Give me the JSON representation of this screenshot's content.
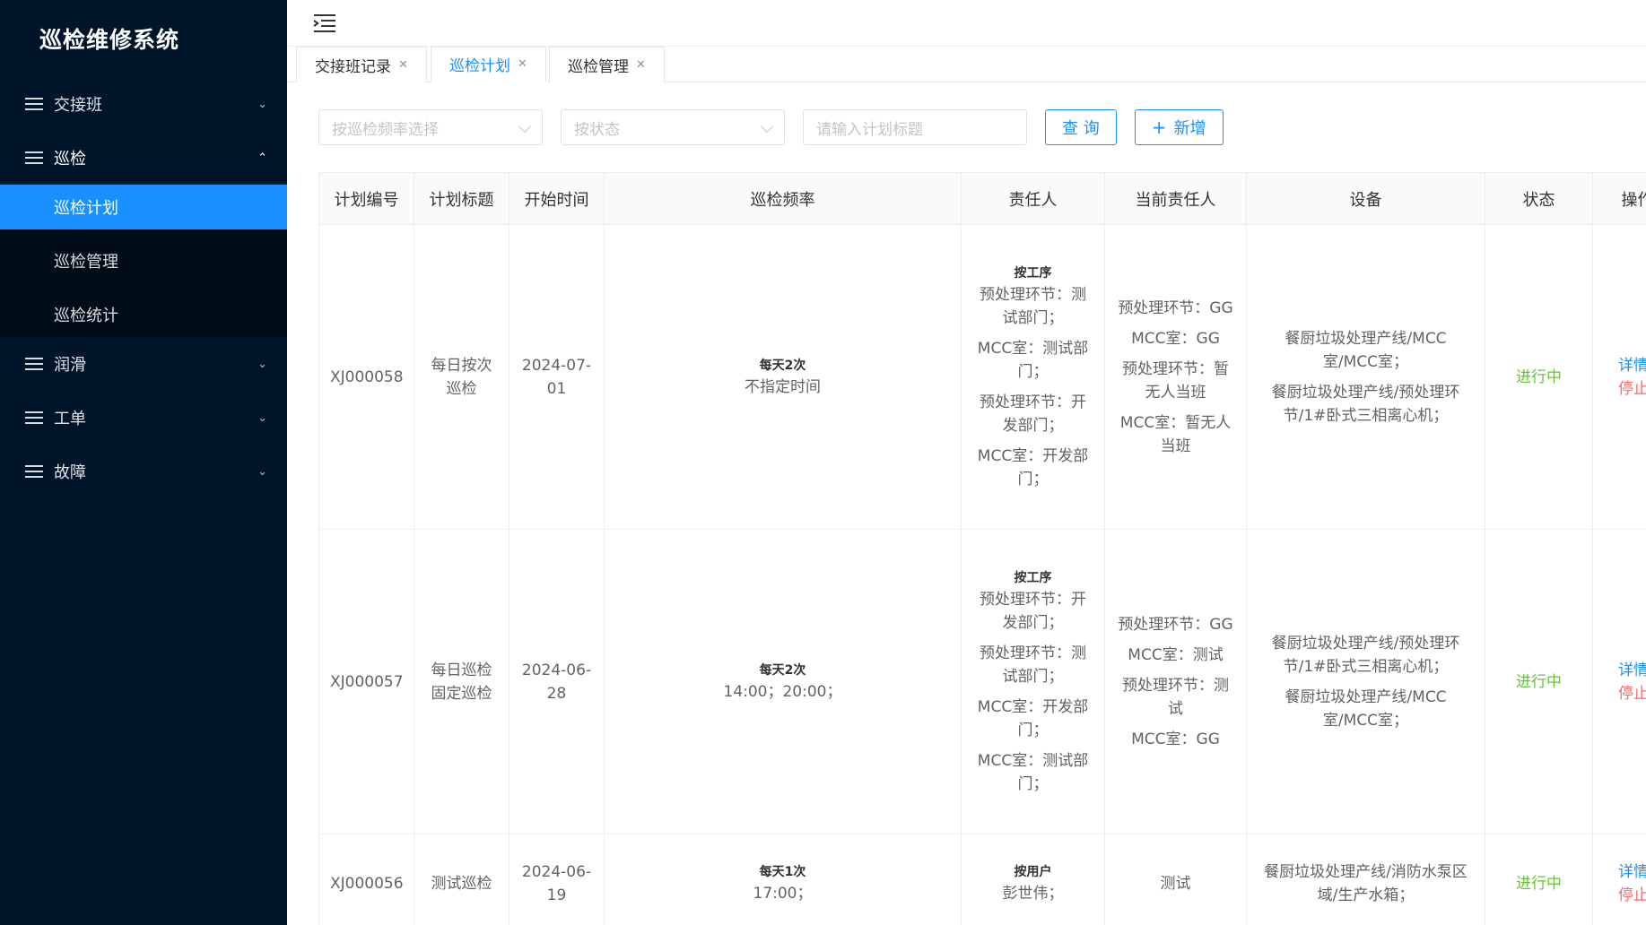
{
  "app": {
    "title": "巡检维修系统"
  },
  "sidebar": {
    "menu": [
      {
        "label": "交接班",
        "expanded": false
      },
      {
        "label": "巡检",
        "expanded": true
      },
      {
        "label": "润滑",
        "expanded": false
      },
      {
        "label": "工单",
        "expanded": false
      },
      {
        "label": "故障",
        "expanded": false
      }
    ],
    "inspection_sub": [
      "巡检计划",
      "巡检管理",
      "巡检统计"
    ]
  },
  "tabs": [
    {
      "label": "交接班记录"
    },
    {
      "label": "巡检计划",
      "active": true
    },
    {
      "label": "巡检管理"
    }
  ],
  "filters": {
    "frequency_placeholder": "按巡检频率选择",
    "status_placeholder": "按状态",
    "title_placeholder": "请输入计划标题",
    "query_label": "查 询",
    "add_label": "新增"
  },
  "table": {
    "headers": [
      "计划编号",
      "计划标题",
      "开始时间",
      "巡检频率",
      "责任人",
      "当前责任人",
      "设备",
      "状态",
      "操作"
    ],
    "rows": [
      {
        "id": "XJ000058",
        "title_lines": [
          "每日按次",
          "巡检"
        ],
        "start_lines": [
          "2024-07-",
          "01"
        ],
        "freq_head": "每天2次",
        "freq_detail": "不指定时间",
        "owner_head": "按工序",
        "owner_lines": [
          "预处理环节：测",
          "试部门；",
          "",
          "MCC室：测试部",
          "门；",
          "",
          "预处理环节：开",
          "发部门；",
          "",
          "MCC室：开发部",
          "门；"
        ],
        "current_lines": [
          "预处理环节：GG",
          "",
          "MCC室：GG",
          "",
          "预处理环节：暂",
          "无人当班",
          "",
          "MCC室：暂无人",
          "当班"
        ],
        "device_lines": [
          "餐厨垃圾处理产线/MCC",
          "室/MCC室；",
          "",
          "餐厨垃圾处理产线/预处理环",
          "节/1#卧式三相离心机；"
        ],
        "status": "进行中",
        "op_detail": "详情",
        "op_stop": "停止"
      },
      {
        "id": "XJ000057",
        "title_lines": [
          "每日巡检",
          "固定巡检"
        ],
        "start_lines": [
          "2024-06-",
          "28"
        ],
        "freq_head": "每天2次",
        "freq_detail": "14:00；20:00；",
        "owner_head": "按工序",
        "owner_lines": [
          "预处理环节：开",
          "发部门；",
          "",
          "预处理环节：测",
          "试部门；",
          "",
          "MCC室：开发部",
          "门；",
          "",
          "MCC室：测试部",
          "门；"
        ],
        "current_lines": [
          "预处理环节：GG",
          "",
          "MCC室：测试",
          "",
          "预处理环节：测",
          "试",
          "",
          "MCC室：GG"
        ],
        "device_lines": [
          "餐厨垃圾处理产线/预处理环",
          "节/1#卧式三相离心机；",
          "",
          "餐厨垃圾处理产线/MCC",
          "室/MCC室；"
        ],
        "status": "进行中",
        "op_detail": "详情",
        "op_stop": "停止"
      },
      {
        "id": "XJ000056",
        "title_lines": [
          "测试巡检"
        ],
        "start_lines": [
          "2024-06-",
          "19"
        ],
        "freq_head": "每天1次",
        "freq_detail": "17:00；",
        "owner_head": "按用户",
        "owner_lines": [
          "彭世伟；"
        ],
        "current_lines": [
          "测试"
        ],
        "device_lines": [
          "餐厨垃圾处理产线/消防水泵区",
          "域/生产水箱；"
        ],
        "status": "进行中",
        "op_detail": "详情",
        "op_stop": "停止"
      }
    ]
  }
}
